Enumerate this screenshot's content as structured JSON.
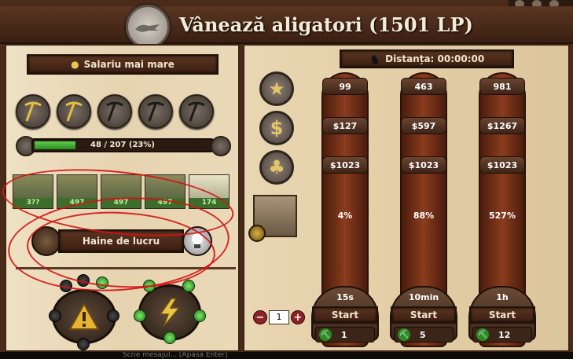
{
  "window": {
    "title": "Vânează aligatori  (1501 LP)"
  },
  "left": {
    "wage_button": "Salariu mai mare",
    "xp_text": "48 / 207 (23%)",
    "xp_fraction": 0.23,
    "workers": [
      {
        "num": "3??"
      },
      {
        "num": "497"
      },
      {
        "num": "497"
      },
      {
        "num": "497"
      },
      {
        "num": "174"
      }
    ],
    "clothes_button": "Haine de lucru"
  },
  "right": {
    "distance": "Distanța: 00:00:00",
    "columns": [
      {
        "xp": "99",
        "money": "$127",
        "luck": "$1023",
        "pct": "4%",
        "duration": "15s",
        "start": "Start",
        "count": "1"
      },
      {
        "xp": "463",
        "money": "$597",
        "luck": "$1023",
        "pct": "88%",
        "duration": "10min",
        "start": "Start",
        "count": "5"
      },
      {
        "xp": "981",
        "money": "$1267",
        "luck": "$1023",
        "pct": "527%",
        "duration": "1h",
        "start": "Start",
        "count": "12"
      }
    ],
    "stepper_value": "1",
    "stepper_minus": "−",
    "stepper_plus": "+",
    "money_symbol": "$",
    "xp_symbol": "★",
    "luck_symbol": "♣"
  },
  "chatbar": {
    "text": "Scrie mesajul...  [Apasă Enter]"
  },
  "colors": {
    "accent_red_circle": "#d21414",
    "xp_green": "#3fb030",
    "panel_bg": "#e6d3b0"
  }
}
